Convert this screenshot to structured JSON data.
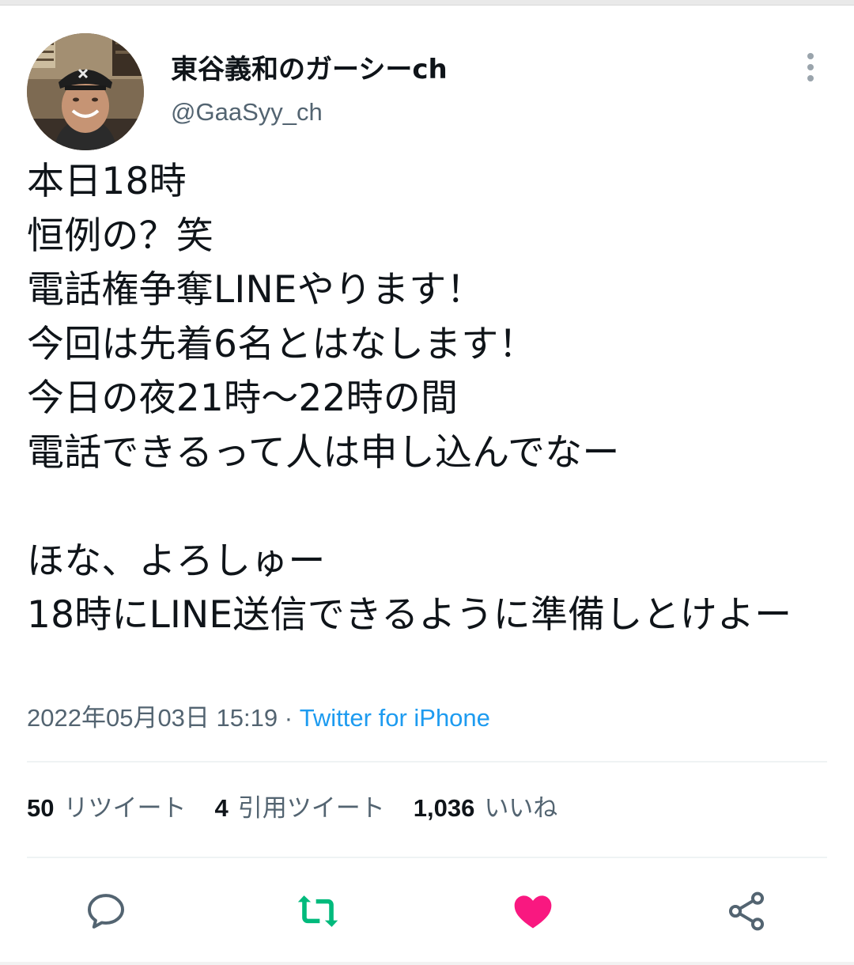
{
  "author": {
    "display_name": "東谷義和のガーシーch",
    "handle": "@GaaSyy_ch"
  },
  "tweet": {
    "text": "本日18時\n恒例の？笑\n電話権争奪LINEやります！\n今回は先着6名とはなします！\n今日の夜21時〜22時の間\n電話できるって人は申し込んでなー\n\nほな、よろしゅー\n18時にLINE送信できるように準備しとけよー",
    "timestamp": "2022年05月03日 15:19",
    "separator": " · ",
    "source": "Twitter for iPhone"
  },
  "stats": {
    "retweets": {
      "count": "50",
      "label": "リツイート"
    },
    "quotes": {
      "count": "4",
      "label": "引用ツイート"
    },
    "likes": {
      "count": "1,036",
      "label": "いいね"
    }
  },
  "actions": {
    "reply_icon": "reply-icon",
    "retweet_icon": "retweet-icon",
    "like_icon": "heart-icon",
    "share_icon": "share-icon"
  },
  "colors": {
    "text_primary": "#0f1419",
    "text_secondary": "#536471",
    "link": "#1d9bf0",
    "retweet_active": "#00ba7c",
    "like_active": "#f91880",
    "divider": "#eff3f4"
  }
}
